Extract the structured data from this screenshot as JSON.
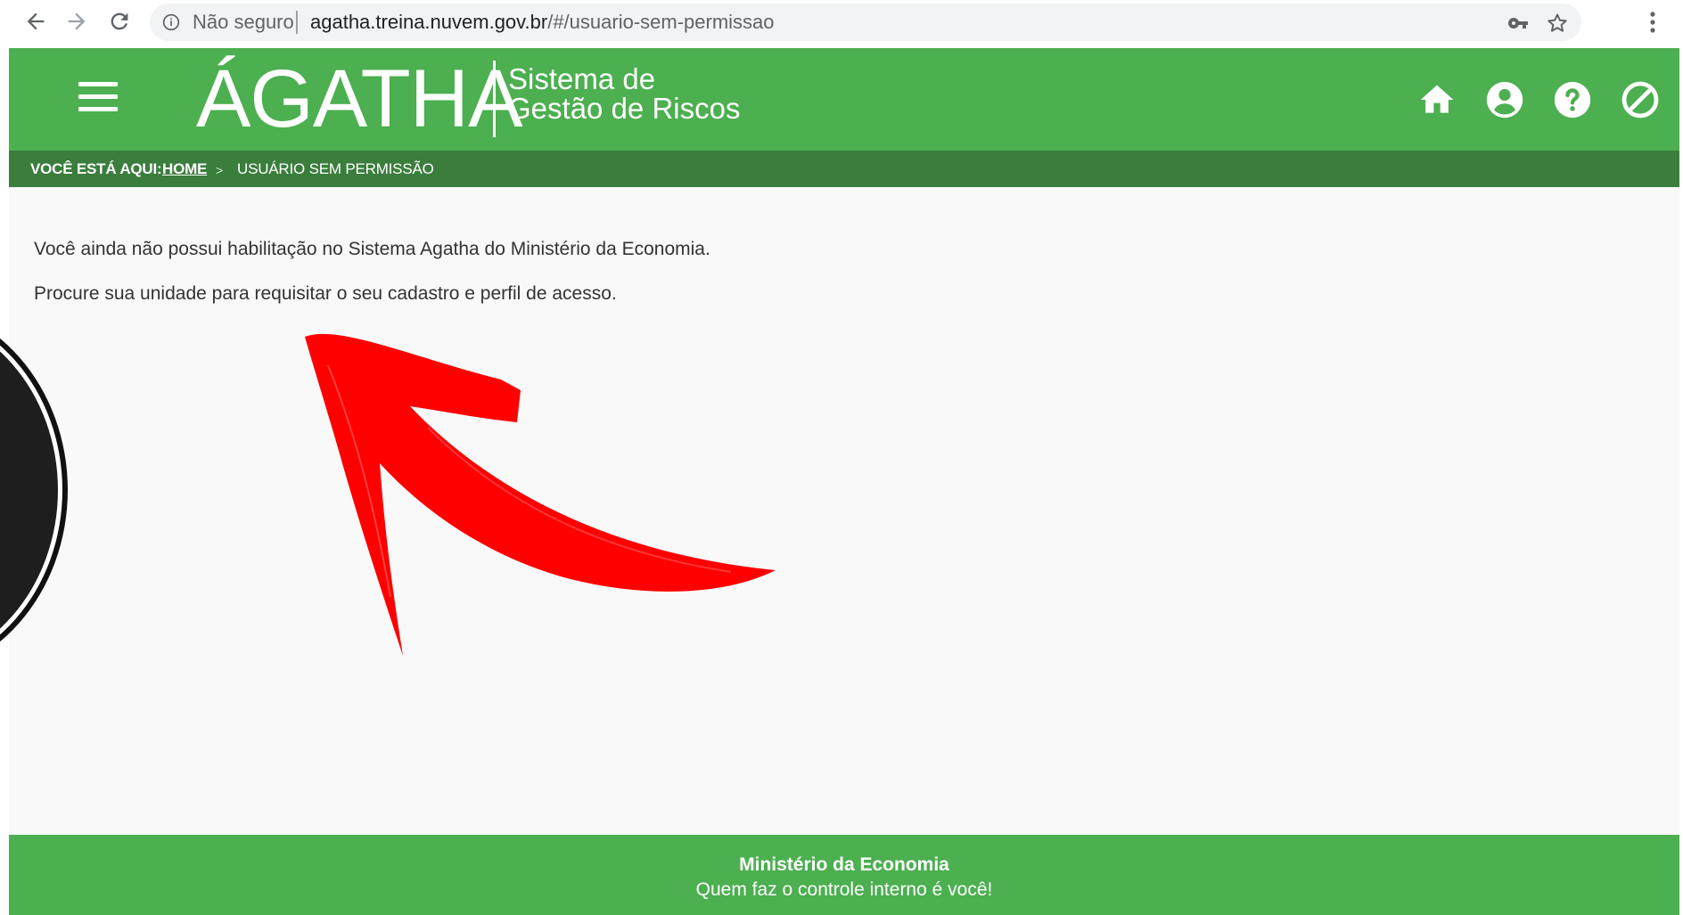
{
  "browser": {
    "security_label": "Não seguro",
    "url_host": "agatha.treina.nuvem.gov.br",
    "url_path": "/#/usuario-sem-permissao",
    "icons": {
      "back": "arrow-left-icon",
      "forward": "arrow-right-icon",
      "reload": "reload-icon",
      "info": "info-icon",
      "key": "key-icon",
      "star": "star-icon",
      "menu": "kebab-menu-icon"
    }
  },
  "header": {
    "logo_title": "ÁGATHA",
    "logo_subtitle_line1": "Sistema de",
    "logo_subtitle_line2": "Gestão de Riscos",
    "icons": [
      "home-icon",
      "account-circle-icon",
      "help-circle-icon",
      "block-icon"
    ],
    "background_color": "#4caf50"
  },
  "breadcrumb": {
    "prefix": "VOCÊ ESTÁ AQUI:",
    "home_label": "HOME",
    "separator": ">",
    "current": "USUÁRIO SEM PERMISSÃO",
    "background_color": "#3a7d3c"
  },
  "main": {
    "message_line1": "Você ainda não possui habilitação no Sistema Agatha do Ministério da Economia.",
    "message_line2": "Procure sua unidade para requisitar o seu cadastro e perfil de acesso."
  },
  "footer": {
    "title": "Ministério da Economia",
    "tagline": "Quem faz o controle interno é você!"
  },
  "annotation": {
    "arrow_color": "#ff0000"
  }
}
